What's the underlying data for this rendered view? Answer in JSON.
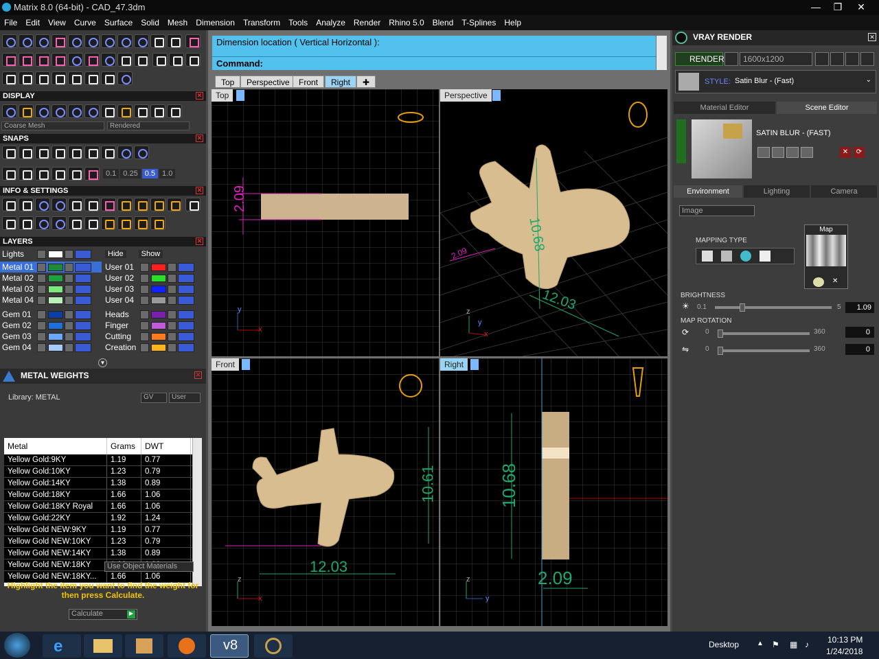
{
  "window": {
    "title": "Matrix 8.0 (64-bit) - CAD_47.3dm",
    "min": "—",
    "max": "❐",
    "close": "✕"
  },
  "menu": [
    "File",
    "Edit",
    "View",
    "Curve",
    "Surface",
    "Solid",
    "Mesh",
    "Dimension",
    "Transform",
    "Tools",
    "Analyze",
    "Render",
    "Rhino 5.0",
    "Blend",
    "T-Splines",
    "Help"
  ],
  "display": {
    "header": "DISPLAY",
    "mesh": "Coarse Mesh",
    "mode": "Rendered"
  },
  "snaps": {
    "header": "SNAPS",
    "values": [
      "0.1",
      "0.25",
      "0.5",
      "1.0"
    ]
  },
  "info": {
    "header": "INFO & SETTINGS"
  },
  "layers": {
    "header": "LAYERS",
    "lights": "Lights",
    "hide": "Hide",
    "show": "Show",
    "left": [
      {
        "name": "Metal 01",
        "color": "#1b8a3b"
      },
      {
        "name": "Metal 02",
        "color": "#22a040"
      },
      {
        "name": "Metal 03",
        "color": "#7de87d"
      },
      {
        "name": "Metal 04",
        "color": "#b8f0b8"
      },
      {
        "name": "Gem 01",
        "color": "#0b3fa6"
      },
      {
        "name": "Gem 02",
        "color": "#1e70d8"
      },
      {
        "name": "Gem 03",
        "color": "#6aa7ff"
      },
      {
        "name": "Gem 04",
        "color": "#a6ccff"
      }
    ],
    "right": [
      {
        "name": "User 01",
        "color": "#ff1e1e"
      },
      {
        "name": "User 02",
        "color": "#27e027"
      },
      {
        "name": "User 03",
        "color": "#1022ff"
      },
      {
        "name": "User 04",
        "color": "#9a9a9a"
      },
      {
        "name": "Heads",
        "color": "#7b1fb0"
      },
      {
        "name": "Finger",
        "color": "#c05ad8"
      },
      {
        "name": "Cutting",
        "color": "#ff7a1a"
      },
      {
        "name": "Creation",
        "color": "#ffb21a"
      }
    ]
  },
  "metal_weights": {
    "header": "METAL WEIGHTS",
    "library": "Library: METAL",
    "gv": "GV",
    "user": "User",
    "columns": [
      "Metal",
      "Grams",
      "DWT"
    ],
    "rows": [
      [
        "Yellow Gold:9KY",
        "1.19",
        "0.77"
      ],
      [
        "Yellow Gold:10KY",
        "1.23",
        "0.79"
      ],
      [
        "Yellow Gold:14KY",
        "1.38",
        "0.89"
      ],
      [
        "Yellow Gold:18KY",
        "1.66",
        "1.06"
      ],
      [
        "Yellow Gold:18KY Royal",
        "1.66",
        "1.06"
      ],
      [
        "Yellow Gold:22KY",
        "1.92",
        "1.24"
      ],
      [
        "Yellow Gold NEW:9KY",
        "1.19",
        "0.77"
      ],
      [
        "Yellow Gold NEW:10KY",
        "1.23",
        "0.79"
      ],
      [
        "Yellow Gold NEW:14KY",
        "1.38",
        "0.89"
      ],
      [
        "Yellow Gold NEW:18KY",
        "1.66",
        "1.06"
      ],
      [
        "Yellow Gold NEW:18KY...",
        "1.66",
        "1.06"
      ]
    ],
    "use_object": "Use Object Materials",
    "hint": "Highlight the item you want to find the weight for then press Calculate.",
    "calculate": "Calculate"
  },
  "command": {
    "prompt": "Dimension location ( Vertical  Horizontal ):",
    "label": "Command:"
  },
  "tabs": [
    "Top",
    "Perspective",
    "Front",
    "Right"
  ],
  "viewports": {
    "top": "Top",
    "perspective": "Perspective",
    "front": "Front",
    "right": "Right"
  },
  "dims": {
    "top": "2.09",
    "persp_a": "2.09",
    "persp_b": "10.68",
    "persp_c": "12.03",
    "front_h": "10.61",
    "front_w": "12.03",
    "right_h": "10.68",
    "right_w": "2.09"
  },
  "axes": {
    "y": "y",
    "x": "x",
    "z": "z"
  },
  "vray": {
    "title": "VRAY RENDER",
    "render": "RENDER",
    "resolution": "1600x1200",
    "style_label": "STYLE:",
    "style": "Satin Blur - (Fast)",
    "tabs": [
      "Material Editor",
      "Scene Editor"
    ],
    "scene_name": "SATIN BLUR - (FAST)",
    "env_tabs": [
      "Environment",
      "Lighting",
      "Camera"
    ],
    "env_type": "Image",
    "mapping": "MAPPING TYPE",
    "map": "Map",
    "brightness": {
      "label": "BRIGHTNESS",
      "min": "0.1",
      "max": "5",
      "value": "1.09",
      "level": 0.22
    },
    "rotation": {
      "label": "MAP ROTATION",
      "min": "0",
      "max": "360",
      "v1": "0",
      "v2": "0"
    }
  },
  "taskbar": {
    "desktop": "Desktop",
    "time": "10:13 PM",
    "date": "1/24/2018"
  },
  "colors": {
    "accent": "#52c1ee",
    "gold": "#d8bd90",
    "dim": "#1fa86a",
    "pink": "#e020c0"
  }
}
